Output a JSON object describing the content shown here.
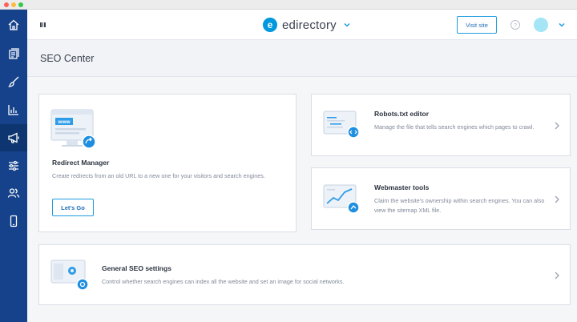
{
  "window": {
    "controls": [
      "close",
      "minimize",
      "maximize"
    ],
    "control_colors": {
      "close": "#fc615d",
      "minimize": "#fdbc40",
      "maximize": "#34c84a"
    }
  },
  "sidebar": {
    "background": "#15428b",
    "items": [
      {
        "icon": "home-icon",
        "active": false
      },
      {
        "icon": "pages-icon",
        "active": false
      },
      {
        "icon": "brush-icon",
        "active": false
      },
      {
        "icon": "bar-chart-icon",
        "active": false
      },
      {
        "icon": "megaphone-icon",
        "active": true
      },
      {
        "icon": "sliders-icon",
        "active": false
      },
      {
        "icon": "users-icon",
        "active": false
      },
      {
        "icon": "mobile-icon",
        "active": false
      }
    ]
  },
  "header": {
    "menu_icon": "hamburger-icon",
    "brand": {
      "logo_letter": "e",
      "name": "edirectory"
    },
    "visit_site_label": "Visit site",
    "help_glyph": "?",
    "accent": "#1e9ce0"
  },
  "page": {
    "title": "SEO Center"
  },
  "cards": {
    "redirect": {
      "illustration_text": "www",
      "title": "Redirect Manager",
      "description": "Create redirects from an old URL to a new one for your visitors and search engines.",
      "button_label": "Let's Go"
    },
    "robots": {
      "title": "Robots.txt editor",
      "description": "Manage the file that tells search engines which pages to crawl."
    },
    "webmaster": {
      "title": "Webmaster tools",
      "description": "Claim the website's ownership within search engines. You can also view the sitemap XML file."
    },
    "general": {
      "title": "General SEO settings",
      "description": "Control whether search engines can index all the website and set an image for social networks."
    }
  }
}
